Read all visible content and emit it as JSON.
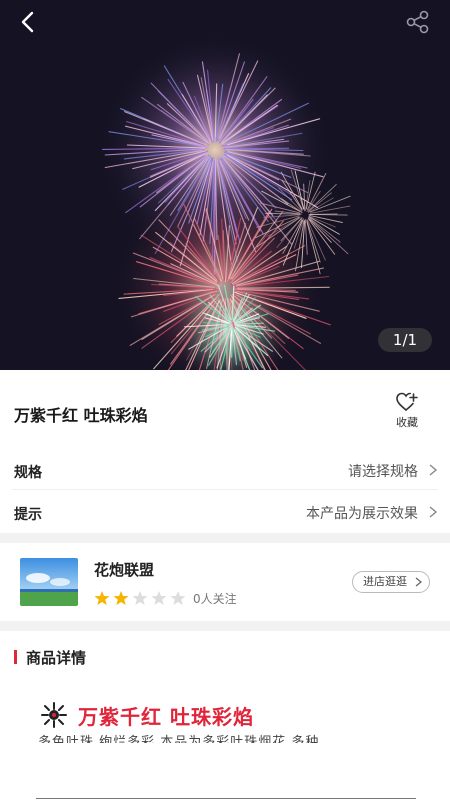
{
  "gallery": {
    "counter": "1/1",
    "back_icon": "back-arrow-icon",
    "share_icon": "share-icon"
  },
  "product": {
    "title": "万紫千红 吐珠彩焰",
    "favorite_label": "收藏",
    "favorite_icon": "heart-plus-icon"
  },
  "options": [
    {
      "label": "规格",
      "value": "请选择规格"
    },
    {
      "label": "提示",
      "value": "本产品为展示效果"
    }
  ],
  "shop": {
    "name": "花炮联盟",
    "rating": 2,
    "rating_max": 5,
    "followers": "0人关注",
    "visit_label": "进店逛逛"
  },
  "details": {
    "heading": "商品详情",
    "banner_title": "万紫千红 吐珠彩焰",
    "banner_subtitle": "多色吐珠  绚烂多彩  本品为多彩吐珠烟花  多种"
  },
  "colors": {
    "accent": "#e0263b",
    "star_filled": "#f5b400",
    "star_empty": "#dddddd",
    "hero_bg": "#141223"
  }
}
